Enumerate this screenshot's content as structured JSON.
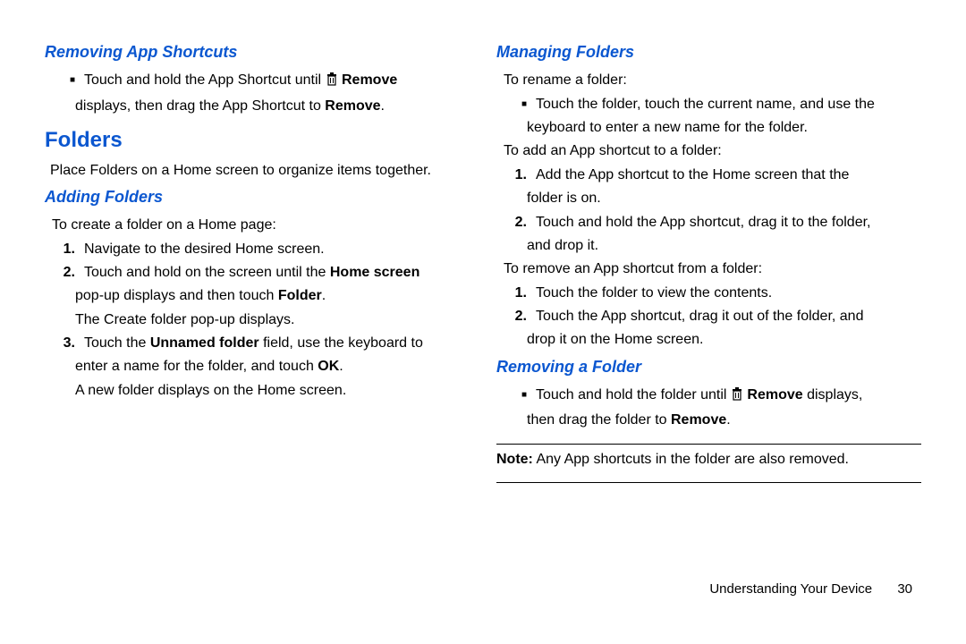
{
  "left": {
    "h_removing_shortcuts": "Removing App Shortcuts",
    "bullet_remove_pre": "Touch and hold the App Shortcut until ",
    "bullet_remove_bold": "Remove",
    "bullet_remove_line2a": "displays, then drag the App Shortcut to ",
    "bullet_remove_line2b": "Remove",
    "bullet_remove_line2c": ".",
    "h_folders": "Folders",
    "folders_intro": "Place Folders on a Home screen to organize items together.",
    "h_adding": "Adding Folders",
    "adding_lead": "To create a folder on a Home page:",
    "n1": "1.",
    "step1": "Navigate to the desired Home screen.",
    "n2": "2.",
    "step2_a": "Touch and hold on the screen until the ",
    "step2_b": "Home screen",
    "step2_line2a": "pop-up displays and then touch ",
    "step2_line2b": "Folder",
    "step2_line2c": ".",
    "step2_sub": "The Create folder pop-up displays.",
    "n3": "3.",
    "step3_a": "Touch the ",
    "step3_b": "Unnamed folder",
    "step3_c": " field, use the keyboard to",
    "step3_line2a": "enter a name for the folder, and touch ",
    "step3_line2b": "OK",
    "step3_line2c": ".",
    "step3_sub": "A new folder displays on the Home screen."
  },
  "right": {
    "h_managing": "Managing Folders",
    "rename_lead": "To rename a folder:",
    "rename_b1": "Touch the folder, touch the current name, and use the",
    "rename_b2": "keyboard to enter a new name for the folder.",
    "add_lead": "To add an App shortcut to a folder:",
    "n1": "1.",
    "add1_a": "Add the App shortcut to the Home screen that the",
    "add1_b": "folder is on.",
    "n2": "2.",
    "add2_a": "Touch and hold the App shortcut, drag it to the folder,",
    "add2_b": "and drop it.",
    "remove_lead": "To remove an App shortcut from a folder:",
    "rem1": "Touch the folder to view the contents.",
    "rem2_a": "Touch the App shortcut, drag it out of the folder, and",
    "rem2_b": "drop it on the Home screen.",
    "h_removing_folder": "Removing a Folder",
    "rf_a": "Touch and hold the folder until ",
    "rf_b": "Remove",
    "rf_c": " displays,",
    "rf_line2a": "then drag the folder to ",
    "rf_line2b": "Remove",
    "rf_line2c": ".",
    "note_label": "Note:",
    "note_text": " Any App shortcuts in the folder are also removed."
  },
  "footer": {
    "section": "Understanding Your Device",
    "page": "30"
  },
  "icons": {
    "trash": "trash-icon",
    "square": "■"
  }
}
